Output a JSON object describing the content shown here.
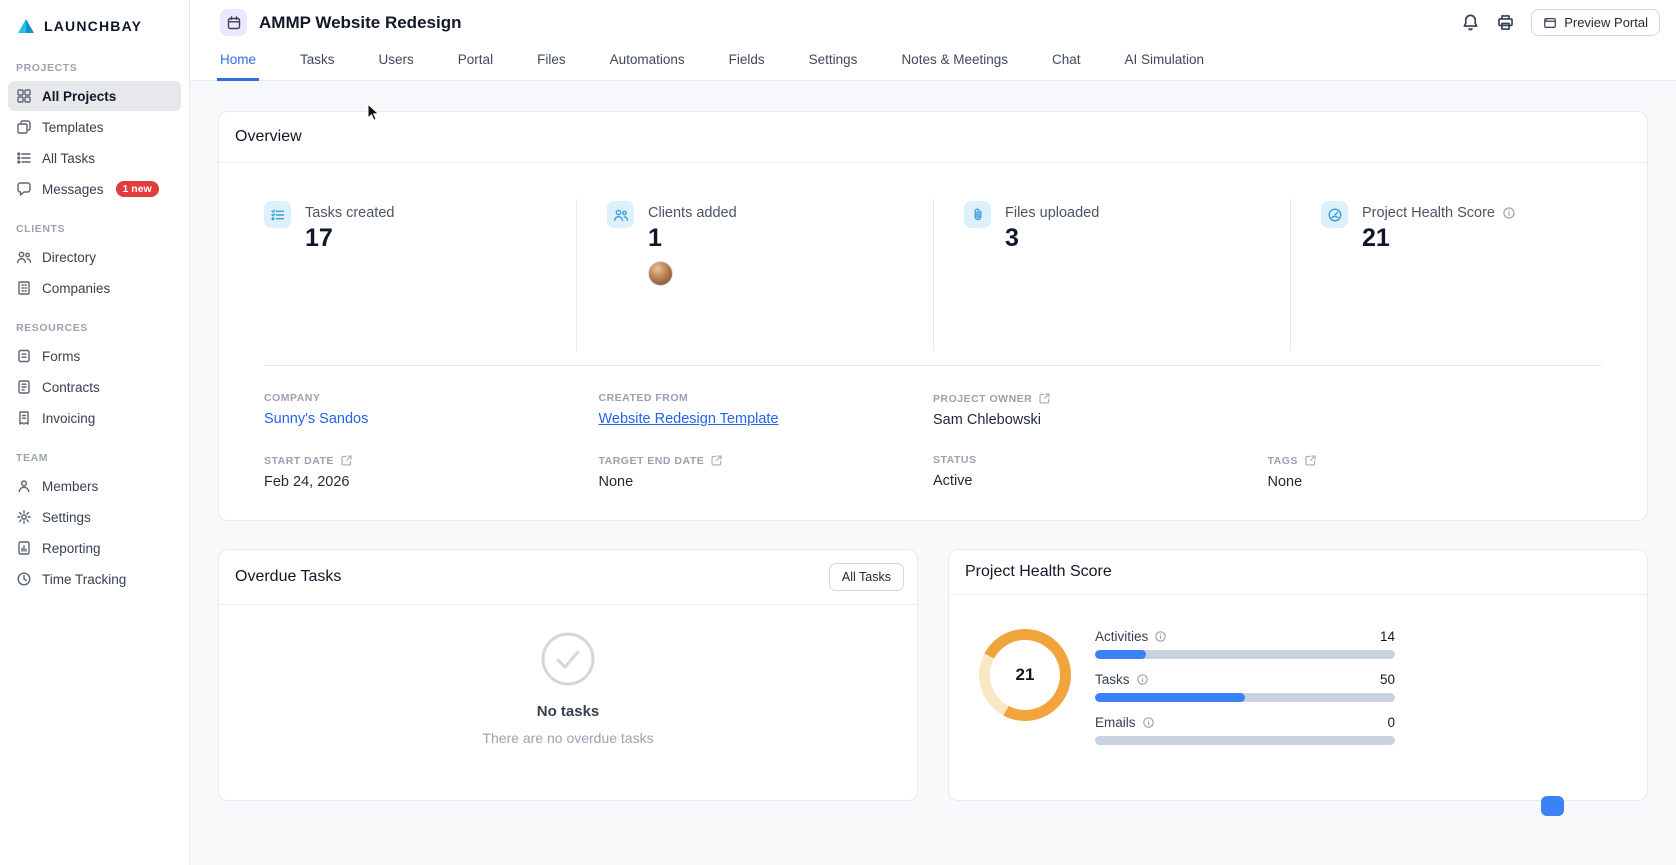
{
  "app": {
    "logo_text": "LAUNCHBAY"
  },
  "sidebar": {
    "sections": [
      {
        "title": "PROJECTS",
        "items": [
          {
            "label": "All Projects",
            "icon": "grid-icon",
            "active": true
          },
          {
            "label": "Templates",
            "icon": "templates-icon"
          },
          {
            "label": "All Tasks",
            "icon": "list-icon"
          },
          {
            "label": "Messages",
            "icon": "message-icon",
            "badge": "1 new"
          }
        ]
      },
      {
        "title": "CLIENTS",
        "items": [
          {
            "label": "Directory",
            "icon": "people-icon"
          },
          {
            "label": "Companies",
            "icon": "building-icon"
          }
        ]
      },
      {
        "title": "RESOURCES",
        "items": [
          {
            "label": "Forms",
            "icon": "form-icon"
          },
          {
            "label": "Contracts",
            "icon": "contract-icon"
          },
          {
            "label": "Invoicing",
            "icon": "invoice-icon"
          }
        ]
      },
      {
        "title": "TEAM",
        "items": [
          {
            "label": "Members",
            "icon": "member-icon"
          },
          {
            "label": "Settings",
            "icon": "gear-icon"
          },
          {
            "label": "Reporting",
            "icon": "report-icon"
          },
          {
            "label": "Time Tracking",
            "icon": "clock-icon"
          }
        ]
      }
    ]
  },
  "header": {
    "title": "AMMP Website Redesign",
    "icons": [
      "bell-icon",
      "printer-icon"
    ],
    "preview_portal_label": "Preview Portal"
  },
  "tabs": {
    "active": "Home",
    "items": [
      "Home",
      "Tasks",
      "Users",
      "Portal",
      "Files",
      "Automations",
      "Fields",
      "Settings",
      "Notes & Meetings",
      "Chat",
      "AI Simulation"
    ]
  },
  "overview": {
    "title": "Overview",
    "stats": [
      {
        "label": "Tasks created",
        "value": "17",
        "icon": "checklist-icon"
      },
      {
        "label": "Clients added",
        "value": "1",
        "icon": "people-icon",
        "has_avatar": true
      },
      {
        "label": "Files uploaded",
        "value": "3",
        "icon": "paperclip-icon"
      },
      {
        "label": "Project Health Score",
        "value": "21",
        "icon": "gauge-icon",
        "has_info": true
      }
    ],
    "meta": {
      "company": {
        "label": "COMPANY",
        "value": "Sunny's Sandos"
      },
      "created_from": {
        "label": "CREATED FROM",
        "value": "Website Redesign Template"
      },
      "project_owner": {
        "label": "PROJECT OWNER",
        "value": "Sam Chlebowski"
      },
      "start_date": {
        "label": "START DATE",
        "value": "Feb 24, 2026"
      },
      "target_end_date": {
        "label": "TARGET END DATE",
        "value": "None"
      },
      "status": {
        "label": "STATUS",
        "value": "Active"
      },
      "tags": {
        "label": "TAGS",
        "value": "None"
      }
    }
  },
  "overdue_tasks": {
    "title": "Overdue Tasks",
    "all_tasks_button": "All Tasks",
    "empty_title": "No tasks",
    "empty_subtitle": "There are no overdue tasks"
  },
  "health": {
    "title": "Project Health Score",
    "score": "21",
    "rows": [
      {
        "label": "Activities",
        "value": "14",
        "pct": 17
      },
      {
        "label": "Tasks",
        "value": "50",
        "pct": 50
      },
      {
        "label": "Emails",
        "value": "0",
        "pct": 0
      }
    ]
  },
  "colors": {
    "accent_blue": "#2f6fe4",
    "link_blue": "#2563eb",
    "badge_red": "#e23d3d",
    "donut_orange": "#f2a43c",
    "bar_fill": "#3b82f6",
    "bar_track": "#c9d3df",
    "stat_icon_blue": "#3d9fdc"
  }
}
